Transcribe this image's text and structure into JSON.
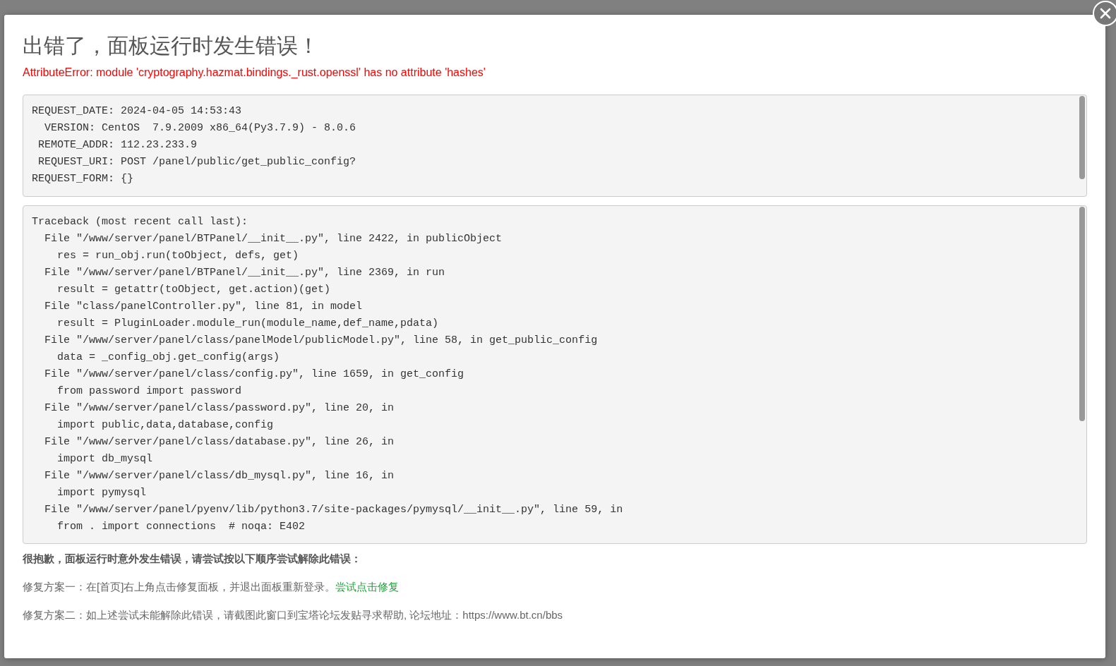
{
  "dialog": {
    "title": "出错了，面板运行时发生错误！",
    "error_message": "AttributeError: module 'cryptography.hazmat.bindings._rust.openssl' has no attribute 'hashes'",
    "request_info": [
      "REQUEST_DATE: 2024-04-05 14:53:43",
      "  VERSION: CentOS  7.9.2009 x86_64(Py3.7.9) - 8.0.6",
      " REMOTE_ADDR: 112.23.233.9",
      " REQUEST_URI: POST /panel/public/get_public_config?",
      "REQUEST_FORM: {}"
    ],
    "traceback": [
      "Traceback (most recent call last):",
      "  File \"/www/server/panel/BTPanel/__init__.py\", line 2422, in publicObject",
      "    res = run_obj.run(toObject, defs, get)",
      "  File \"/www/server/panel/BTPanel/__init__.py\", line 2369, in run",
      "    result = getattr(toObject, get.action)(get)",
      "  File \"class/panelController.py\", line 81, in model",
      "    result = PluginLoader.module_run(module_name,def_name,pdata)",
      "  File \"/www/server/panel/class/panelModel/publicModel.py\", line 58, in get_public_config",
      "    data = _config_obj.get_config(args)",
      "  File \"/www/server/panel/class/config.py\", line 1659, in get_config",
      "    from password import password",
      "  File \"/www/server/panel/class/password.py\", line 20, in",
      "    import public,data,database,config",
      "  File \"/www/server/panel/class/database.py\", line 26, in",
      "    import db_mysql",
      "  File \"/www/server/panel/class/db_mysql.py\", line 16, in",
      "    import pymysql",
      "  File \"/www/server/panel/pyenv/lib/python3.7/site-packages/pymysql/__init__.py\", line 59, in",
      "    from . import connections  # noqa: E402"
    ],
    "help_heading": "很抱歉，面板运行时意外发生错误，请尝试按以下顺序尝试解除此错误：",
    "fixes": [
      {
        "text": "修复方案一：在[首页]右上角点击修复面板，并退出面板重新登录。",
        "link": "尝试点击修复"
      },
      {
        "text": "修复方案二：如上述尝试未能解除此错误，请截图此窗口到宝塔论坛发贴寻求帮助, 论坛地址：https://www.bt.cn/bbs"
      }
    ]
  }
}
